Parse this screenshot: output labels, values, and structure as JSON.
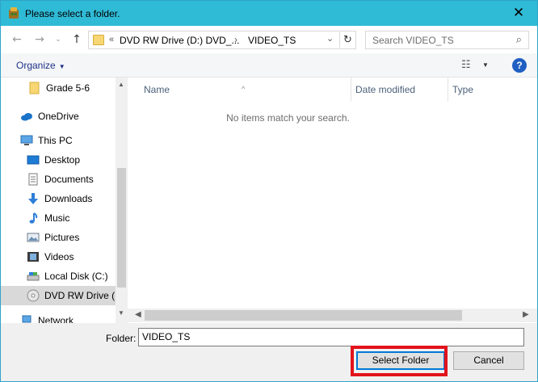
{
  "window": {
    "title": "Please select a folder.",
    "close_label": "✕",
    "colors": {
      "titlebar": "#2fbad6",
      "accent": "#0078d7",
      "highlight": "#e2131c"
    }
  },
  "navbar": {
    "back_icon": "←",
    "forward_icon": "→",
    "recent_icon": "⌄",
    "up_icon": "↑",
    "address": {
      "chevron": "«",
      "segment1": "DVD RW Drive (D:) DVD_...",
      "separator": "›",
      "segment2": "VIDEO_TS",
      "dropdown_icon": "⌄",
      "refresh_icon": "↻"
    },
    "search": {
      "placeholder": "Search VIDEO_TS",
      "icon": "⌕"
    }
  },
  "toolbar": {
    "organize_label": "Organize",
    "organize_caret": "▼",
    "views_icon": "☷",
    "views_caret": "▼",
    "help_label": "?"
  },
  "navpane": {
    "items": [
      {
        "label": "Grade 5-6",
        "icon": "folder-icon"
      },
      {
        "label": "OneDrive",
        "icon": "cloud-icon"
      },
      {
        "label": "This PC",
        "icon": "computer-icon"
      },
      {
        "label": "Desktop",
        "icon": "desktop-icon"
      },
      {
        "label": "Documents",
        "icon": "documents-icon"
      },
      {
        "label": "Downloads",
        "icon": "download-icon"
      },
      {
        "label": "Music",
        "icon": "music-icon"
      },
      {
        "label": "Pictures",
        "icon": "pictures-icon"
      },
      {
        "label": "Videos",
        "icon": "videos-icon"
      },
      {
        "label": "Local Disk (C:)",
        "icon": "disk-icon"
      },
      {
        "label": "DVD RW Drive (D",
        "icon": "dvd-icon",
        "selected": true
      },
      {
        "label": "Network",
        "icon": "network-icon"
      }
    ],
    "scroll_up": "▲",
    "scroll_down": "▼"
  },
  "filepane": {
    "columns": [
      "Name",
      "Date modified",
      "Type"
    ],
    "sort_caret": "^",
    "empty_message": "No items match your search.",
    "scroll_left": "◀",
    "scroll_right": "▶"
  },
  "bottom": {
    "folder_label": "Folder:",
    "folder_value": "VIDEO_TS",
    "select_button": "Select Folder",
    "cancel_button": "Cancel"
  }
}
